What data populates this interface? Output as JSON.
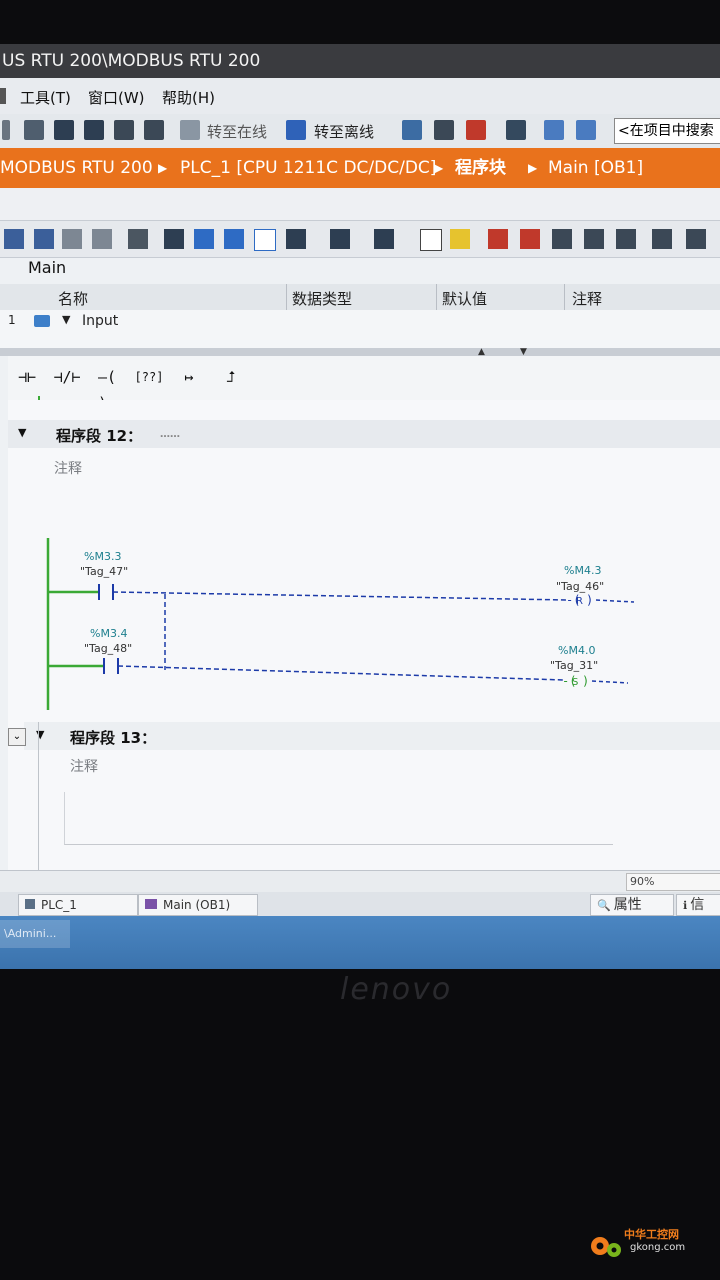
{
  "window": {
    "title": "US RTU 200\\MODBUS RTU 200"
  },
  "menu": {
    "tools": "工具(T)",
    "window": "窗口(W)",
    "help": "帮助(H)"
  },
  "toolbar": {
    "go_online": "转至在线",
    "go_offline": "转至离线",
    "search_placeholder": "<在项目中搜索"
  },
  "breadcrumb": {
    "items": [
      "MODBUS RTU 200",
      "PLC_1 [CPU 1211C DC/DC/DC]",
      "程序块",
      "Main [OB1]"
    ]
  },
  "block": {
    "name": "Main"
  },
  "interface_table": {
    "headers": [
      "名称",
      "数据类型",
      "默认值",
      "注释"
    ],
    "rows": [
      {
        "index": "1",
        "name": "Input"
      }
    ]
  },
  "ladder_toolbar": {
    "no_contact": "⊣⊢",
    "nc_contact": "⊣/⊢",
    "coil": "–( )–",
    "box": "[??]",
    "branch_open": "↦",
    "branch_close": "⮥"
  },
  "networks": [
    {
      "title": "程序段 12：",
      "dots": "……",
      "comment": "注释",
      "rungs": [
        {
          "contact_address": "%M3.3",
          "contact_tag": "\"Tag_47\"",
          "coil_address": "%M4.3",
          "coil_tag": "\"Tag_46\"",
          "coil_type": "R"
        },
        {
          "contact_address": "%M3.4",
          "contact_tag": "\"Tag_48\"",
          "coil_address": "%M4.0",
          "coil_tag": "\"Tag_31\"",
          "coil_type": "S"
        }
      ]
    },
    {
      "title": "程序段 13：",
      "comment": "注释"
    }
  ],
  "status": {
    "zoom": "90%"
  },
  "bottom_tabs": {
    "plc": "PLC_1",
    "main": "Main (OB1)",
    "properties": "属性",
    "info": "信"
  },
  "taskbar": {
    "item": "\\Admini..."
  },
  "brand": {
    "bezel_logo": "lenovo",
    "watermark_name": "中华工控网",
    "watermark_url": "gkong.com"
  },
  "colors": {
    "orange_bar": "#e9721c",
    "power_rail": "#3aa935",
    "wire": "#1c3aa8",
    "address": "#1d7f8e"
  }
}
